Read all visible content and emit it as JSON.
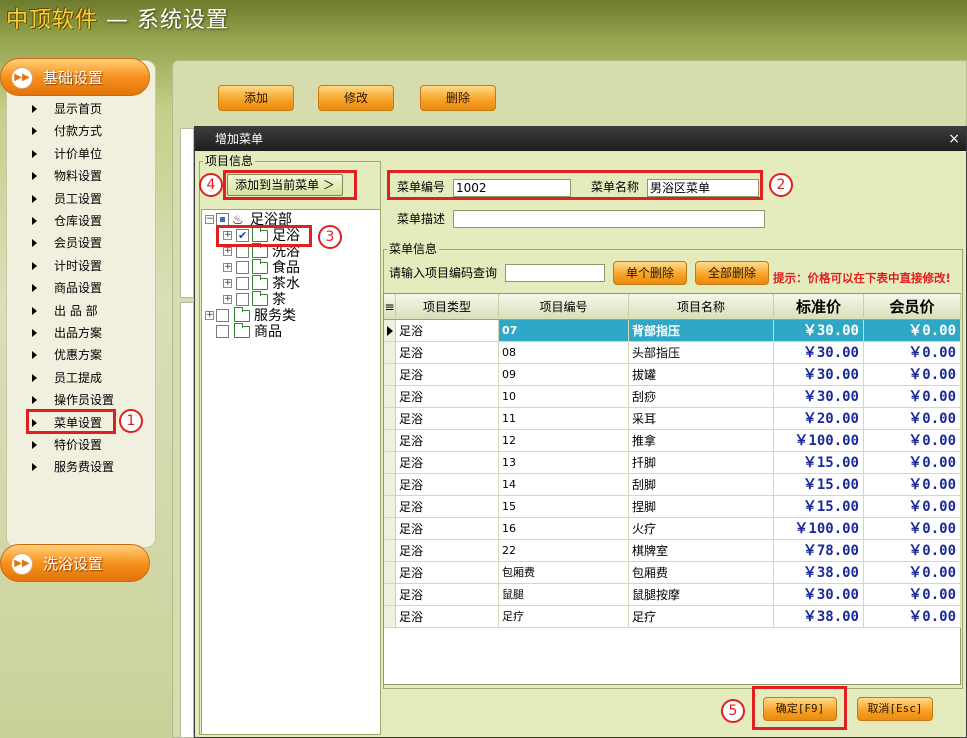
{
  "app": {
    "brand": "中顶软件",
    "title": " — 系统设置"
  },
  "sidebar": {
    "header_basic": "基础设置",
    "header_bath": "洗浴设置",
    "items": [
      "显示首页",
      "付款方式",
      "计价单位",
      "物料设置",
      "员工设置",
      "仓库设置",
      "会员设置",
      "计时设置",
      "商品设置",
      "出 品 部",
      "出品方案",
      "优惠方案",
      "员工提成",
      "操作员设置",
      "菜单设置",
      "特价设置",
      "服务费设置"
    ]
  },
  "toolbar": {
    "add": "添加",
    "edit": "修改",
    "delete": "删除"
  },
  "dialog": {
    "title": "增加菜单",
    "close": "×",
    "project_group": "项目信息",
    "add_to_menu": "添加到当前菜单 ＞",
    "tree": {
      "root": "足浴部",
      "child_selected": "足浴",
      "child_wash": "洗浴",
      "child_food": "食品",
      "child_tea_water": "茶水",
      "child_tea": "茶",
      "service": "服务类",
      "goods": "商品"
    },
    "menu_no_label": "菜单编号",
    "menu_no_value": "1002",
    "menu_name_label": "菜单名称",
    "menu_name_value": "男浴区菜单",
    "menu_desc_label": "菜单描述",
    "menu_desc_value": "",
    "menu_info_group": "菜单信息",
    "search_label": "请输入项目编码查询",
    "search_value": "",
    "delete_one": "单个删除",
    "delete_all": "全部删除",
    "hint": "提示：价格可以在下表中直接修改!",
    "ok": "确定[F9]",
    "cancel": "取消[Esc]",
    "columns": [
      "项目类型",
      "项目编号",
      "项目名称",
      "标准价",
      "会员价"
    ],
    "rows": [
      {
        "type": "足浴",
        "code": "07",
        "name": "背部指压",
        "std": "￥30.00",
        "member": "￥0.00"
      },
      {
        "type": "足浴",
        "code": "08",
        "name": "头部指压",
        "std": "￥30.00",
        "member": "￥0.00"
      },
      {
        "type": "足浴",
        "code": "09",
        "name": "拔罐",
        "std": "￥30.00",
        "member": "￥0.00"
      },
      {
        "type": "足浴",
        "code": "10",
        "name": "刮痧",
        "std": "￥30.00",
        "member": "￥0.00"
      },
      {
        "type": "足浴",
        "code": "11",
        "name": "采耳",
        "std": "￥20.00",
        "member": "￥0.00"
      },
      {
        "type": "足浴",
        "code": "12",
        "name": "推拿",
        "std": "￥100.00",
        "member": "￥0.00"
      },
      {
        "type": "足浴",
        "code": "13",
        "name": "扦脚",
        "std": "￥15.00",
        "member": "￥0.00"
      },
      {
        "type": "足浴",
        "code": "14",
        "name": "刮脚",
        "std": "￥15.00",
        "member": "￥0.00"
      },
      {
        "type": "足浴",
        "code": "15",
        "name": "捏脚",
        "std": "￥15.00",
        "member": "￥0.00"
      },
      {
        "type": "足浴",
        "code": "16",
        "name": "火疗",
        "std": "￥100.00",
        "member": "￥0.00"
      },
      {
        "type": "足浴",
        "code": "22",
        "name": "棋牌室",
        "std": "￥78.00",
        "member": "￥0.00"
      },
      {
        "type": "足浴",
        "code": "包厢费",
        "name": "包厢费",
        "std": "￥38.00",
        "member": "￥0.00"
      },
      {
        "type": "足浴",
        "code": "鼠腿",
        "name": "鼠腿按摩",
        "std": "￥30.00",
        "member": "￥0.00"
      },
      {
        "type": "足浴",
        "code": "足疗",
        "name": "足疗",
        "std": "￥38.00",
        "member": "￥0.00"
      }
    ]
  },
  "markers": [
    "1",
    "2",
    "3",
    "4",
    "5"
  ],
  "colors": {
    "accent_orange": "#f6a024",
    "highlight_red": "#e02020",
    "selected_row": "#2fa7c6",
    "price_blue": "#1a2a9a"
  }
}
